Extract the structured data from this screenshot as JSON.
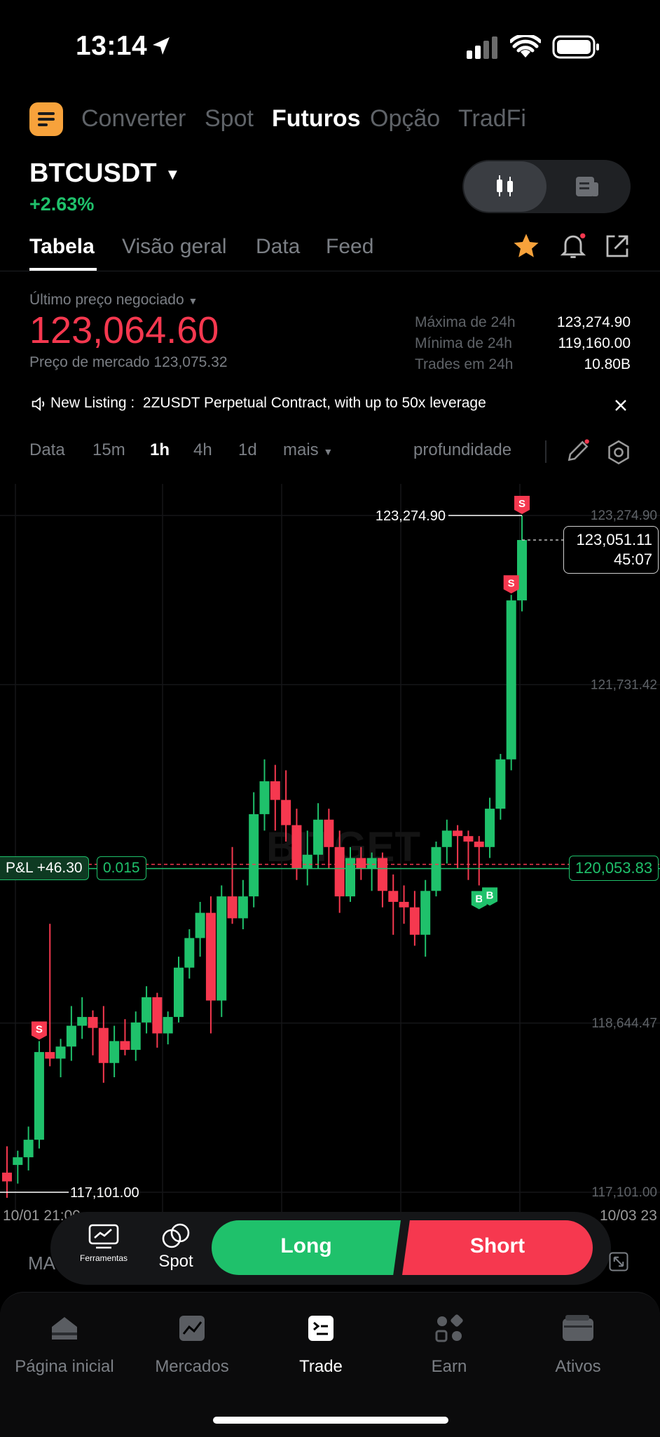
{
  "status": {
    "time": "13:14"
  },
  "product_tabs": [
    {
      "label": "Converter",
      "active": false
    },
    {
      "label": "Spot",
      "active": false
    },
    {
      "label": "Futuros",
      "active": true
    },
    {
      "label": "Opção",
      "active": false
    },
    {
      "label": "TradFi",
      "active": false
    }
  ],
  "symbol": {
    "name": "BTCUSDT",
    "change": "+2.63%"
  },
  "section_tabs": [
    {
      "label": "Tabela",
      "active": true
    },
    {
      "label": "Visão geral",
      "active": false
    },
    {
      "label": "Data",
      "active": false
    },
    {
      "label": "Feed",
      "active": false
    }
  ],
  "price": {
    "last_label": "Último preço negociado",
    "last_value": "123,064.60",
    "mark_label": "Preço de mercado 123,075.32"
  },
  "stats": [
    {
      "label": "Máxima de 24h",
      "value": "123,274.90"
    },
    {
      "label": "Mínima de 24h",
      "value": "119,160.00"
    },
    {
      "label": "Trades em 24h",
      "value": "10.80B"
    }
  ],
  "notice": {
    "label": "New Listing :",
    "text": "2ZUSDT Perpetual Contract, with up to 50x leverage"
  },
  "intervals": [
    {
      "label": "Data",
      "active": false
    },
    {
      "label": "15m",
      "active": false
    },
    {
      "label": "1h",
      "active": true
    },
    {
      "label": "4h",
      "active": false
    },
    {
      "label": "1d",
      "active": false
    },
    {
      "label": "mais",
      "active": false
    }
  ],
  "depth_label": "profundidade",
  "chart_data": {
    "type": "candlestick",
    "watermark": "BITGET",
    "y_axis_ticks": [
      "123,274.90",
      "121,731.42",
      "120,053.83",
      "118,644.47",
      "117,101.00"
    ],
    "x_axis_ticks": [
      "10/01 21:00",
      "10/03 23"
    ],
    "high_label": "123,274.90",
    "low_label": "117,101.00",
    "current_price": "123,051.11",
    "countdown": "45:07",
    "position": {
      "pnl": "P&L +46.30",
      "size": "0.015",
      "entry": "120,053.83"
    },
    "candles": [
      [
        117280,
        117520,
        117050,
        117200
      ],
      [
        117350,
        117480,
        117180,
        117420
      ],
      [
        117420,
        117700,
        117300,
        117580
      ],
      [
        117580,
        118480,
        117500,
        118380
      ],
      [
        118380,
        119550,
        118250,
        118320
      ],
      [
        118320,
        118500,
        118150,
        118430
      ],
      [
        118430,
        118800,
        118300,
        118620
      ],
      [
        118620,
        118880,
        118500,
        118700
      ],
      [
        118700,
        118760,
        118350,
        118600
      ],
      [
        118600,
        118800,
        118100,
        118280
      ],
      [
        118280,
        118620,
        118150,
        118480
      ],
      [
        118480,
        118680,
        118350,
        118400
      ],
      [
        118400,
        118750,
        118300,
        118650
      ],
      [
        118650,
        118980,
        118550,
        118880
      ],
      [
        118880,
        118920,
        118420,
        118550
      ],
      [
        118550,
        118750,
        118450,
        118700
      ],
      [
        118700,
        119250,
        118650,
        119150
      ],
      [
        119150,
        119500,
        119050,
        119420
      ],
      [
        119420,
        119750,
        119250,
        119650
      ],
      [
        119650,
        119800,
        118550,
        118850
      ],
      [
        118850,
        119900,
        118700,
        119800
      ],
      [
        119800,
        120250,
        119550,
        119600
      ],
      [
        119600,
        119950,
        119500,
        119800
      ],
      [
        119800,
        120750,
        119700,
        120550
      ],
      [
        120550,
        121050,
        120400,
        120850
      ],
      [
        120850,
        121000,
        120400,
        120680
      ],
      [
        120680,
        120950,
        120300,
        120450
      ],
      [
        120450,
        120600,
        119950,
        120050
      ],
      [
        120050,
        120400,
        119900,
        120180
      ],
      [
        120180,
        120650,
        120050,
        120500
      ],
      [
        120500,
        120600,
        120050,
        120250
      ],
      [
        120250,
        120400,
        119650,
        119800
      ],
      [
        119800,
        120250,
        119750,
        120150
      ],
      [
        120150,
        120250,
        119950,
        120050
      ],
      [
        120050,
        120200,
        119850,
        120150
      ],
      [
        120150,
        120200,
        119700,
        119850
      ],
      [
        119850,
        120000,
        119450,
        119750
      ],
      [
        119750,
        119900,
        119550,
        119700
      ],
      [
        119700,
        119850,
        119350,
        119450
      ],
      [
        119450,
        119950,
        119250,
        119850
      ],
      [
        119850,
        120300,
        119800,
        120250
      ],
      [
        120250,
        120500,
        120100,
        120400
      ],
      [
        120400,
        120450,
        120050,
        120350
      ],
      [
        120350,
        120400,
        119950,
        120300
      ],
      [
        120300,
        120350,
        119900,
        120250
      ],
      [
        120250,
        120700,
        120150,
        120600
      ],
      [
        120600,
        121100,
        120500,
        121050
      ],
      [
        121050,
        122550,
        120950,
        122500
      ],
      [
        122500,
        123274.9,
        122400,
        123051.11
      ]
    ],
    "markers": [
      {
        "type": "S",
        "candle": 3
      },
      {
        "type": "S",
        "candle": 47
      },
      {
        "type": "S",
        "candle": 48
      },
      {
        "type": "B",
        "candle": 44
      },
      {
        "type": "B",
        "candle": 45
      }
    ]
  },
  "trade_bar": {
    "tools_label": "Ferramentas",
    "spot_label": "Spot",
    "long_label": "Long",
    "short_label": "Short",
    "ma_label": "MA"
  },
  "bottom_nav": [
    {
      "label": "Página inicial",
      "icon": "home-icon",
      "active": false
    },
    {
      "label": "Mercados",
      "icon": "chart-icon",
      "active": false
    },
    {
      "label": "Trade",
      "icon": "trade-icon",
      "active": true
    },
    {
      "label": "Earn",
      "icon": "earn-icon",
      "active": false
    },
    {
      "label": "Ativos",
      "icon": "wallet-icon",
      "active": false
    }
  ],
  "colors": {
    "up": "#1fc16b",
    "down": "#f6384f",
    "accent": "#f7a23b"
  }
}
